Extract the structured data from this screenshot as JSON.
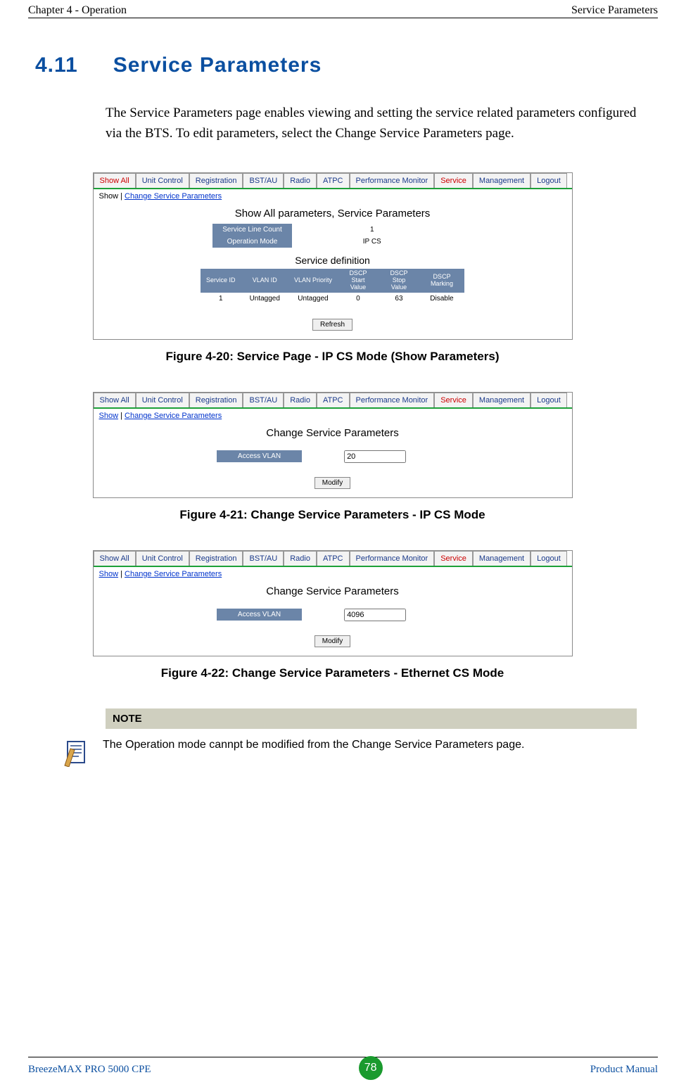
{
  "header": {
    "left": "Chapter 4 - Operation",
    "right": "Service Parameters"
  },
  "section": {
    "number": "4.11",
    "title": "Service Parameters"
  },
  "intro": "The Service Parameters page enables viewing and setting the service related parameters configured via the BTS. To edit parameters, select the Change Service Parameters page.",
  "tabs": [
    "Show All",
    "Unit Control",
    "Registration",
    "BST/AU",
    "Radio",
    "ATPC",
    "Performance Monitor",
    "Service",
    "Management",
    "Logout"
  ],
  "fig20": {
    "caption": "Figure 4-20: Service Page - IP CS Mode (Show Parameters)",
    "sublink_plain": "Show | ",
    "sublink_link": "Change Service Parameters",
    "title": "Show All parameters, Service Parameters",
    "params": [
      {
        "label": "Service Line Count",
        "value": "1"
      },
      {
        "label": "Operation Mode",
        "value": "IP CS"
      }
    ],
    "subtitle": "Service definition",
    "def_headers": [
      "Service ID",
      "VLAN ID",
      "VLAN Priority",
      "DSCP Start Value",
      "DSCP Stop Value",
      "DSCP Marking"
    ],
    "def_row": [
      "1",
      "Untagged",
      "Untagged",
      "0",
      "63",
      "Disable"
    ],
    "button": "Refresh"
  },
  "fig21": {
    "caption": "Figure 4-21: Change Service Parameters - IP CS Mode",
    "sublink_link1": "Show",
    "sublink_plain": " | ",
    "sublink_link2": "Change Service Parameters",
    "title": "Change Service Parameters",
    "label": "Access VLAN",
    "value": "20",
    "button": "Modify"
  },
  "fig22": {
    "caption": "Figure 4-22: Change Service Parameters - Ethernet CS Mode",
    "sublink_link1": "Show",
    "sublink_plain": " | ",
    "sublink_link2": "Change Service Parameters",
    "title": "Change Service Parameters",
    "label": "Access VLAN",
    "value": "4096",
    "button": "Modify"
  },
  "note": {
    "heading": "NOTE",
    "text": "The Operation mode cannpt be modified from the Change Service Parameters page."
  },
  "footer": {
    "left": "BreezeMAX PRO 5000 CPE",
    "page": "78",
    "right": "Product Manual"
  }
}
